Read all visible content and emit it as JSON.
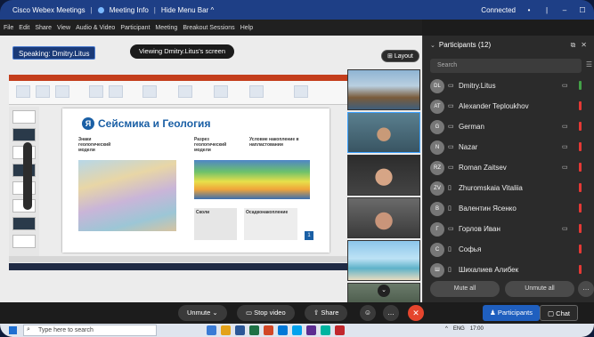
{
  "title_bar": {
    "app": "Cisco Webex Meetings",
    "meeting_info": "Meeting Info",
    "hide_menu": "Hide Menu Bar ^",
    "connected": "Connected",
    "controls": [
      "•",
      "|",
      "–",
      "☐"
    ]
  },
  "menu": [
    "File",
    "Edit",
    "Share",
    "View",
    "Audio & Video",
    "Participant",
    "Meeting",
    "Breakout Sessions",
    "Help"
  ],
  "share": {
    "speaking": "Speaking: Dmitry.Litus",
    "viewing": "Viewing Dmitry.Litus's screen",
    "layout": "Layout"
  },
  "slide": {
    "title": "Сейсмика и Геология",
    "labels": [
      "Знаки геологический модели",
      "Разрез геологический модели",
      "Условие накопление в напластовании",
      "Сколи",
      "Осадконакопление"
    ]
  },
  "participants": {
    "header": "Participants (12)",
    "search_placeholder": "Search",
    "list": [
      {
        "initials": "DL",
        "name": "Dmitry.Litus",
        "mic": "on",
        "device": "pc"
      },
      {
        "initials": "AT",
        "name": "Alexander Teploukhov",
        "mic": "off",
        "device": "pc"
      },
      {
        "initials": "G",
        "name": "German",
        "mic": "off",
        "device": "pc"
      },
      {
        "initials": "N",
        "name": "Nazar",
        "mic": "off",
        "device": "pc"
      },
      {
        "initials": "RZ",
        "name": "Roman Zaitsev",
        "mic": "off",
        "device": "pc"
      },
      {
        "initials": "ZV",
        "name": "Zhuromskaia Vitaliia",
        "mic": "off",
        "device": "phone"
      },
      {
        "initials": "В",
        "name": "Валентин Ясенко",
        "mic": "off",
        "device": "phone"
      },
      {
        "initials": "Г",
        "name": "Горлов Иван",
        "mic": "off",
        "device": "pc"
      },
      {
        "initials": "С",
        "name": "Софья",
        "mic": "off",
        "device": "phone"
      },
      {
        "initials": "Ш",
        "name": "Шихалиев Алибек",
        "mic": "off",
        "device": "phone"
      }
    ],
    "mute_all": "Mute all",
    "unmute_all": "Unmute all"
  },
  "controls": {
    "unmute": "Unmute",
    "stop_video": "Stop video",
    "share": "Share",
    "participants": "Participants",
    "chat": "Chat"
  },
  "taskbar": {
    "search_placeholder": "Type here to search",
    "tray": [
      "^",
      "ENG",
      "17:00"
    ]
  },
  "colors": {
    "accent": "#1f5fbf",
    "end_call": "#e5452d",
    "mic_on": "#43a047",
    "mic_off": "#e53935"
  }
}
